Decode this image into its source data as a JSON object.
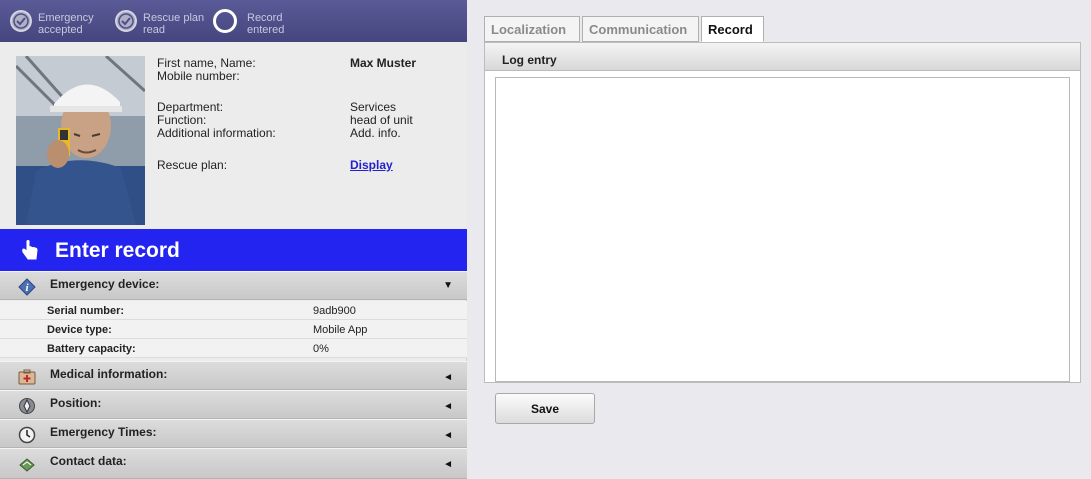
{
  "steps": [
    {
      "line1": "Emergency",
      "line2": "accepted",
      "state": "done"
    },
    {
      "line1": "Rescue plan",
      "line2": "read",
      "state": "done"
    },
    {
      "line1": "Record",
      "line2": "entered",
      "state": "current"
    }
  ],
  "person": {
    "name_label": "First name, Name:",
    "name_value": "Max Muster",
    "mobile_label": "Mobile number:",
    "mobile_value": "",
    "department_label": "Department:",
    "department_value": "Services",
    "function_label": "Function:",
    "function_value": "head of unit",
    "additional_label": "Additional information:",
    "additional_value": "Add. info.",
    "rescue_plan_label": "Rescue plan:",
    "rescue_plan_link": "Display"
  },
  "enter_record": {
    "label": "Enter record"
  },
  "sections": {
    "emergency_device": {
      "title": "Emergency device:",
      "expanded": true,
      "arrow": "▼"
    },
    "medical": {
      "title": "Medical information:",
      "arrow": "◄"
    },
    "position": {
      "title": "Position:",
      "arrow": "◄"
    },
    "times": {
      "title": "Emergency Times:",
      "arrow": "◄"
    },
    "contact": {
      "title": "Contact data:",
      "arrow": "◄"
    }
  },
  "device": {
    "rows": [
      {
        "key": "Serial number:",
        "value": "9adb900"
      },
      {
        "key": "Device type:",
        "value": "Mobile App"
      },
      {
        "key": "Battery capacity:",
        "value": "0%"
      }
    ]
  },
  "tabs": [
    {
      "label": "Localization",
      "active": false
    },
    {
      "label": "Communication",
      "active": false
    },
    {
      "label": "Record",
      "active": true
    }
  ],
  "log": {
    "header": "Log entry",
    "value": ""
  },
  "save_label": "Save",
  "colors": {
    "header_bar": "#4f4f8c",
    "enter_record_bg": "#2424f0",
    "link": "#2222cc"
  }
}
